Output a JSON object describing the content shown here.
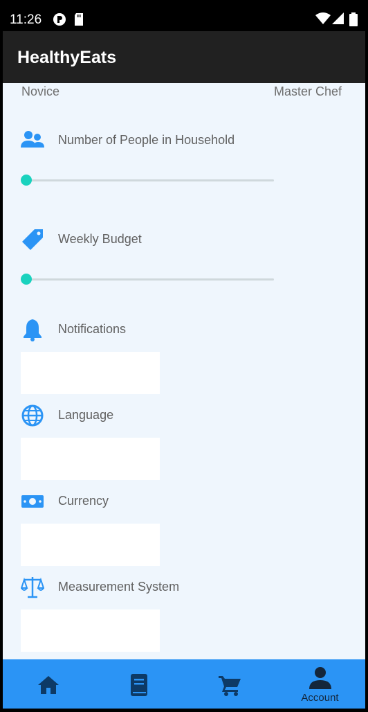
{
  "status_bar": {
    "time": "11:26"
  },
  "app": {
    "title": "HealthyEats"
  },
  "skill_level": {
    "min_label": "Novice",
    "max_label": "Master Chef"
  },
  "settings": {
    "household": {
      "label": "Number of People in Household",
      "icon": "people-icon",
      "value_fraction": 0
    },
    "budget": {
      "label": "Weekly Budget",
      "icon": "price-tag-icon",
      "value_fraction": 0
    },
    "notifications": {
      "label": "Notifications",
      "icon": "bell-icon"
    },
    "language": {
      "label": "Language",
      "icon": "globe-icon"
    },
    "currency": {
      "label": "Currency",
      "icon": "banknote-icon"
    },
    "measurement": {
      "label": "Measurement System",
      "icon": "scale-icon"
    }
  },
  "bottom_nav": {
    "items": [
      {
        "name": "home",
        "icon": "home-icon",
        "label": ""
      },
      {
        "name": "recipes",
        "icon": "book-icon",
        "label": ""
      },
      {
        "name": "cart",
        "icon": "cart-icon",
        "label": ""
      },
      {
        "name": "account",
        "icon": "person-icon",
        "label": "Account",
        "active": true
      }
    ]
  },
  "colors": {
    "app_bar": "#212121",
    "background": "#eff6fd",
    "accent_icon": "#2b94f5",
    "slider": "#1ad2be",
    "bottom_nav": "#2b94f5",
    "nav_icon": "#0d3a66"
  }
}
